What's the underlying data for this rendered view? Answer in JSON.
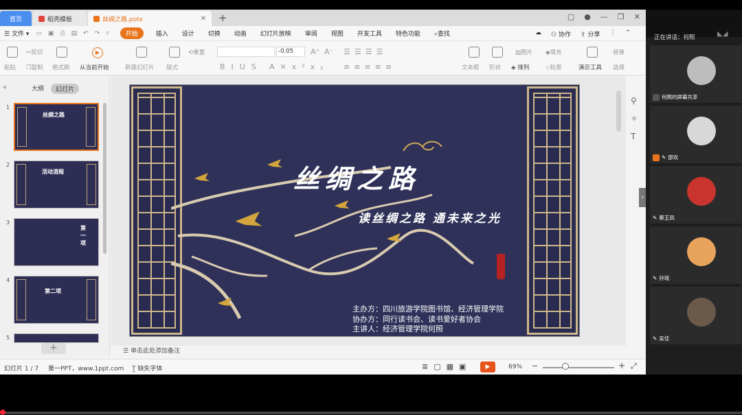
{
  "tabs": {
    "home": "首页",
    "template": "稻壳模板",
    "document": "丝绸之路.potx",
    "new_tab": "+"
  },
  "menu": {
    "file": "文件",
    "items": [
      "开始",
      "插入",
      "设计",
      "切换",
      "动画",
      "幻灯片放映",
      "审阅",
      "视图",
      "开发工具",
      "特色功能"
    ],
    "search": "查找",
    "collaborate": "协作",
    "share": "分享"
  },
  "ribbon": {
    "paste": "粘贴",
    "cut": "剪切",
    "copy": "复制",
    "format_painter": "格式刷",
    "play_from_current": "从当前开始",
    "new_slide": "新建幻灯片",
    "layout": "版式",
    "reset": "重置",
    "font_size": "-0.05",
    "textbox": "文本框",
    "shapes": "形状",
    "arrange": "排列",
    "picture": "图片",
    "fill": "填充",
    "outline": "轮廓",
    "present_tools": "演示工具",
    "replace": "替换",
    "select": "选择"
  },
  "left_panel": {
    "tab_outline": "大纲",
    "tab_slides": "幻灯片",
    "thumbs": [
      {
        "num": "1",
        "title": "丝绸之路"
      },
      {
        "num": "2",
        "title": "活动流程"
      },
      {
        "num": "3",
        "title": "第一项"
      },
      {
        "num": "4",
        "title": "第二项"
      },
      {
        "num": "5",
        "title": ""
      }
    ]
  },
  "slide": {
    "title": "丝绸之路",
    "subtitle": "读丝绸之路 通未来之光",
    "organizer": "主办方：四川旅游学院图书馆、经济管理学院",
    "co_organizer": "协办方：同行读书会、读书爱好者协会",
    "speaker": "主讲人：经济管理学院何照"
  },
  "notes_placeholder": "单击此处添加备注",
  "status": {
    "slide_count": "幻灯片 1 / 7",
    "theme": "第一PPT，www.1ppt.com",
    "missing_font": "缺失字体",
    "zoom": "69%"
  },
  "meeting": {
    "title": "正在讲话：何照",
    "participants": [
      {
        "name": "何照的屏幕共享",
        "color": "#bdbdbd"
      },
      {
        "name": "邵欢",
        "color": "#d8d8d8"
      },
      {
        "name": "蔡王凤",
        "color": "#c9342e"
      },
      {
        "name": "孙瑶",
        "color": "#e8a45c"
      },
      {
        "name": "吴佳",
        "color": "#6b5a4a"
      }
    ]
  },
  "colors": {
    "accent": "#e8741b",
    "slide_bg": "#2f3159",
    "gold": "#cfb88a",
    "home_tab": "#4a8ef0"
  }
}
